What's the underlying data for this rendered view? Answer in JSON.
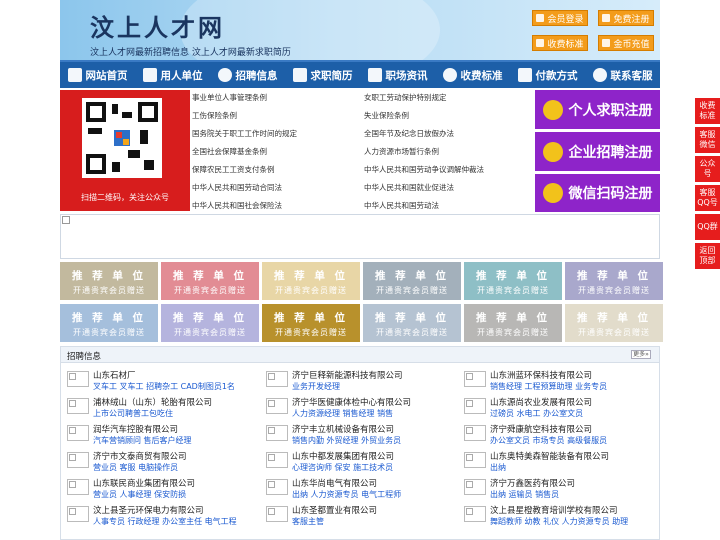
{
  "header": {
    "title": "汶上人才网",
    "subtitle": "汶上人才网最新招聘信息    汶上人才网最新求职简历",
    "buttons": [
      "会员登录",
      "免费注册",
      "收费标准",
      "金币充值"
    ]
  },
  "nav": {
    "items": [
      {
        "label": "网站首页",
        "icon": "home-icon"
      },
      {
        "label": "用人单位",
        "icon": "building-icon"
      },
      {
        "label": "招聘信息",
        "icon": "chat-icon"
      },
      {
        "label": "求职简历",
        "icon": "resume-icon"
      },
      {
        "label": "职场资讯",
        "icon": "news-icon"
      },
      {
        "label": "收费标准",
        "icon": "money-icon"
      },
      {
        "label": "付款方式",
        "icon": "payment-icon"
      },
      {
        "label": "联系客服",
        "icon": "phone-icon"
      }
    ]
  },
  "qr": {
    "caption": "扫描二维码，关注公众号"
  },
  "laws": [
    "事业单位人事管理条例",
    "女职工劳动保护特别规定",
    "工伤保险条例",
    "失业保险条例",
    "国务院关于职工工作时间的规定",
    "全国年节及纪念日放假办法",
    "全国社会保障基金条例",
    "人力资源市场暂行条例",
    "保障农民工工资支付条例",
    "中华人民共和国劳动争议调解仲裁法",
    "中华人民共和国劳动合同法",
    "中华人民共和国就业促进法",
    "中华人民共和国社会保险法",
    "中华人民共和国劳动法"
  ],
  "cta": [
    {
      "label": "个人求职注册",
      "icon": "person-icon"
    },
    {
      "label": "企业招聘注册",
      "icon": "company-icon"
    },
    {
      "label": "微信扫码注册",
      "icon": "wechat-icon"
    }
  ],
  "recommend": {
    "line1": "推 荐 单 位",
    "line2": "开通贵宾会员赠送",
    "colors": [
      "#c2b99e",
      "#e28c94",
      "#e8d6a6",
      "#a3b0bb",
      "#8ebfc6",
      "#a9a8cc",
      "#a5bfdc",
      "#b5b4de",
      "#b8912c",
      "#b5c3d2",
      "#b8b7b5",
      "#e2dccb"
    ]
  },
  "jobs": {
    "title": "招聘信息",
    "more": "更多»",
    "rows": [
      [
        {
          "company": "山东石材厂",
          "positions": "叉车工 叉车工 招聘杂工 CAD制图员1名"
        },
        {
          "company": "济宁巨释新能源科技有限公司",
          "positions": "业务开发经理"
        },
        {
          "company": "山东洲蓝环保科技有限公司",
          "positions": "销售经理 工程预算助理 业务专员"
        }
      ],
      [
        {
          "company": "浦林绒山（山东）轮胎有限公司",
          "positions": "上市公司聘普工包吃住"
        },
        {
          "company": "济宁华医健康体检中心有限公司",
          "positions": "人力资源经理 销售经理 销售"
        },
        {
          "company": "山东源尚农业发展有限公司",
          "positions": "过磅员 水电工 办公室文员"
        }
      ],
      [
        {
          "company": "润华汽车控股有限公司",
          "positions": "汽车营销顾问 售后客户经理"
        },
        {
          "company": "济宁丰立机械设备有限公司",
          "positions": "销售内勤 外贸经理 外贸业务员"
        },
        {
          "company": "济宁舜康航空科技有限公司",
          "positions": "办公室文员 市场专员 高级餐服员"
        }
      ],
      [
        {
          "company": "济宁市文泰商贸有限公司",
          "positions": "营业员 客服 电脑操作员"
        },
        {
          "company": "山东中都发展集团有限公司",
          "positions": "心理咨询师 保安 施工技术员"
        },
        {
          "company": "山东奥特美森智能装备有限公司",
          "positions": "出纳"
        }
      ],
      [
        {
          "company": "山东联民商业集团有限公司",
          "positions": "营业员 人事经理 保安防损"
        },
        {
          "company": "山东华尚电气有限公司",
          "positions": "出纳 人力资源专员 电气工程师"
        },
        {
          "company": "济宁万鑫医药有限公司",
          "positions": "出纳 运输员 销售员"
        }
      ],
      [
        {
          "company": "汶上县圣元环保电力有限公司",
          "positions": "人事专员 行政经理 办公室主任 电气工程"
        },
        {
          "company": "山东圣都置业有限公司",
          "positions": "客服主管"
        },
        {
          "company": "汶上县星橙教育培训学校有限公司",
          "positions": "舞蹈教师 幼教 礼仪 人力资源专员 助理"
        }
      ]
    ]
  },
  "side": [
    "收费标准",
    "客服微信",
    "公众号",
    "客服QQ号",
    "QQ群",
    "返回顶部"
  ]
}
